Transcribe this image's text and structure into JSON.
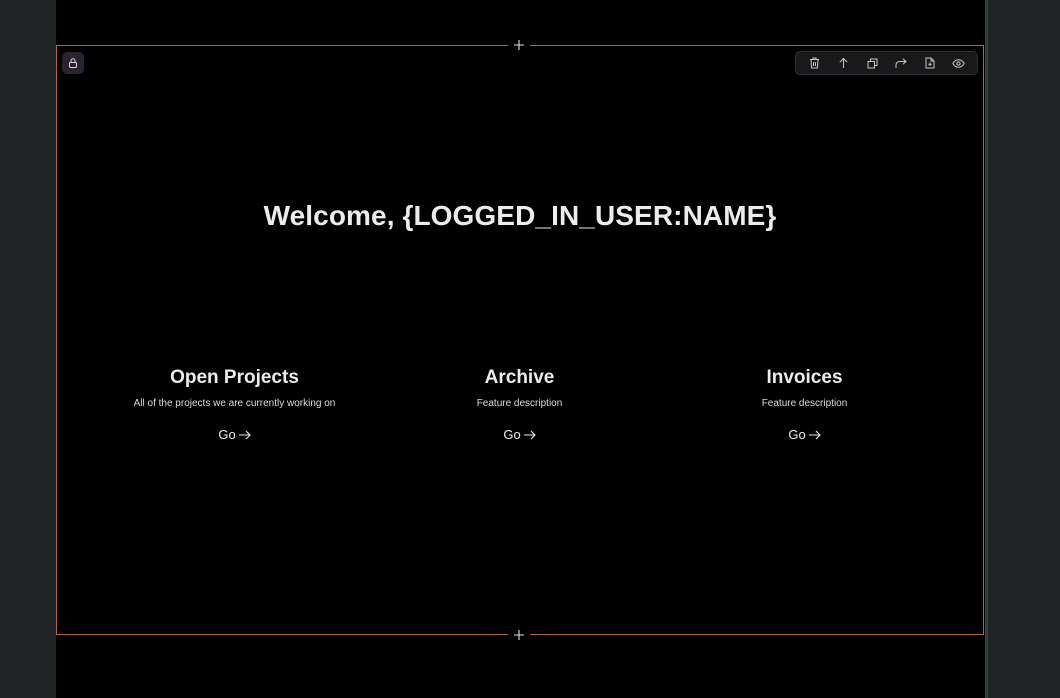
{
  "page": {
    "headline": "Welcome, {LOGGED_IN_USER:NAME}"
  },
  "toolbar": {
    "items": [
      "trash-icon",
      "arrow-up-icon",
      "duplicate-icon",
      "forward-icon",
      "file-icon",
      "eye-icon"
    ]
  },
  "features": [
    {
      "title": "Open Projects",
      "description": "All of the projects we are currently working on",
      "link": "Go"
    },
    {
      "title": "Archive",
      "description": "Feature description",
      "link": "Go"
    },
    {
      "title": "Invoices",
      "description": "Feature description",
      "link": "Go"
    }
  ],
  "colors": {
    "section_border": "#b0663a",
    "background": "#000000",
    "outer": "#202425"
  }
}
